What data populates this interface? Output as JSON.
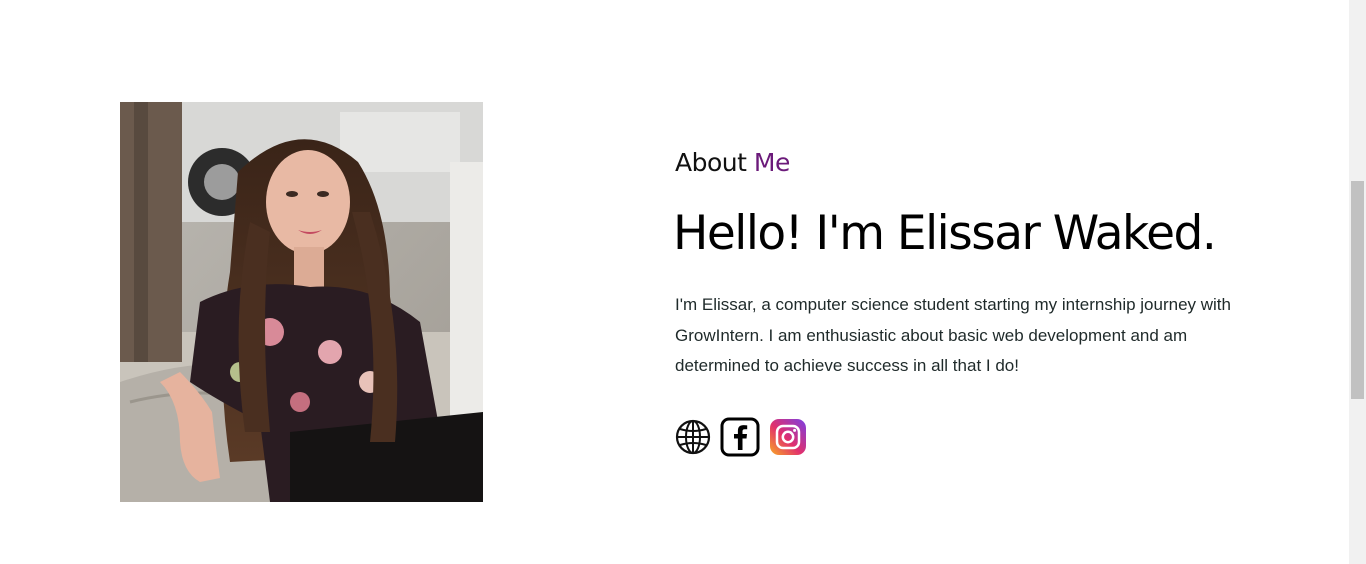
{
  "about": {
    "label_prefix": "About",
    "label_accent": "Me",
    "headline": "Hello! I'm Elissar Waked.",
    "bio": "I'm Elissar, a computer science student starting my internship journey with GrowIntern. I am enthusiastic about basic web development and am determined to achieve success in all that I do!"
  },
  "social_links": [
    {
      "icon": "globe-icon"
    },
    {
      "icon": "facebook-icon"
    },
    {
      "icon": "instagram-icon"
    }
  ],
  "colors": {
    "accent": "#6b1a7a",
    "text": "#1f2a2a",
    "instagram_gradient": [
      "#f9a825",
      "#e1306c",
      "#7b3fe4"
    ]
  }
}
